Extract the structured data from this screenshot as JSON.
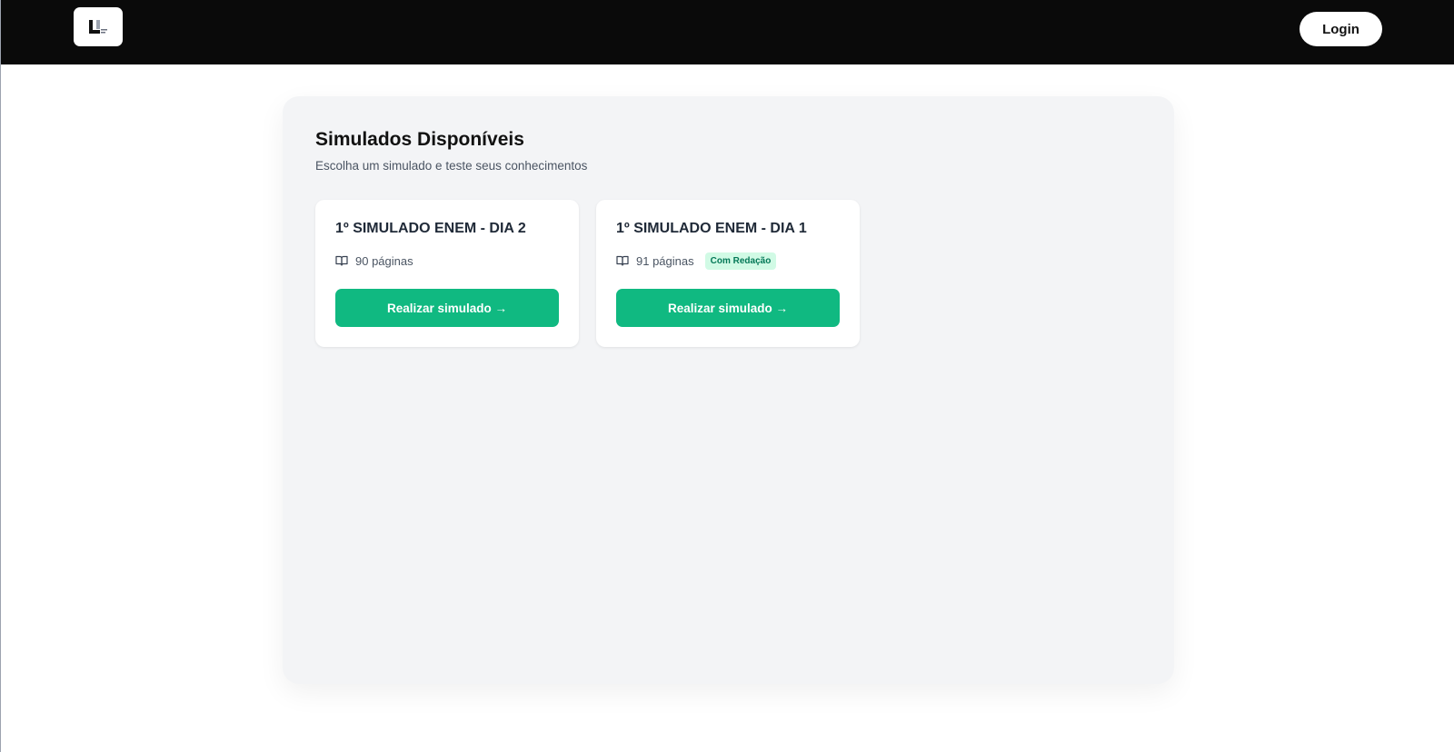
{
  "header": {
    "logo_icon": "u-logo-icon",
    "login_label": "Login",
    "background_color": "#0a0a0a"
  },
  "main": {
    "title": "Simulados Disponíveis",
    "subtitle": "Escolha um simulado e teste seus conhecimentos",
    "cards": [
      {
        "title": "1º SIMULADO ENEM - DIA 2",
        "pages": "90 páginas",
        "badge": "",
        "button_label": "Realizar simulado →",
        "icon": "book-open-icon"
      },
      {
        "title": "1º SIMULADO ENEM - DIA 1",
        "pages": "91 páginas",
        "badge": "Com Redação",
        "button_label": "Realizar simulado →",
        "icon": "book-open-icon"
      }
    ]
  },
  "colors": {
    "accent": "#10b981",
    "badge_bg": "#d1fae5",
    "badge_text": "#047857",
    "panel_bg": "#f3f4f6"
  }
}
